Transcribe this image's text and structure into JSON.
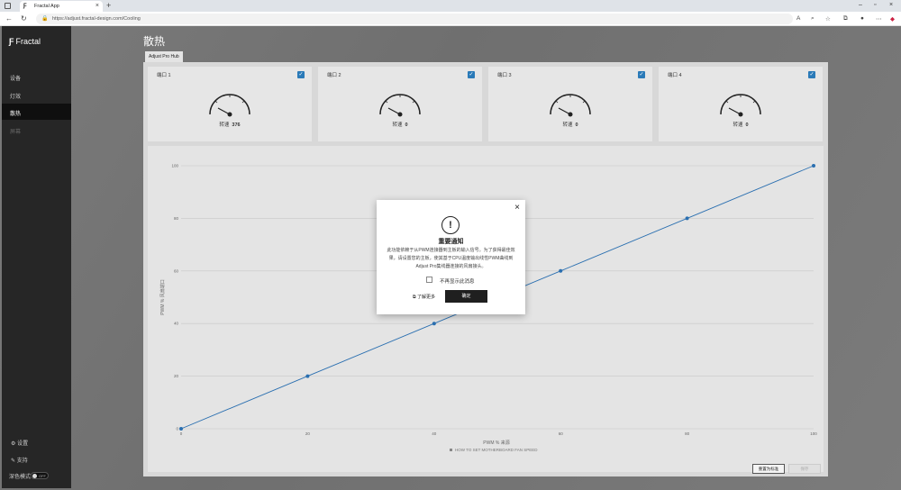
{
  "browser": {
    "tab_title": "Fractal App",
    "tab_favicon": "Ƒ",
    "url": "https://adjust.fractal-design.com/Cooling"
  },
  "sidebar": {
    "brand": "Fractal",
    "items": [
      {
        "label": "设备"
      },
      {
        "label": "灯效"
      },
      {
        "label": "散热"
      },
      {
        "label": "屏幕"
      }
    ],
    "settings_label": "设置",
    "support_label": "支持",
    "dark_mode_label": "深色模式",
    "dark_mode_state": "OFF"
  },
  "page": {
    "title": "散热",
    "hub_tab": "Adjust Pro Hub"
  },
  "fans": [
    {
      "port": "端口 1",
      "speed_label": "转速",
      "speed": "376",
      "needle": 0.2
    },
    {
      "port": "端口 2",
      "speed_label": "转速",
      "speed": "0",
      "needle": 0.2
    },
    {
      "port": "端口 3",
      "speed_label": "转速",
      "speed": "0",
      "needle": 0.2
    },
    {
      "port": "端口 4",
      "speed_label": "转速",
      "speed": "0",
      "needle": 0.2
    }
  ],
  "chart_data": {
    "type": "line",
    "x": [
      0,
      20,
      40,
      60,
      80,
      100
    ],
    "y": [
      0,
      20,
      40,
      60,
      80,
      100
    ],
    "xlabel": "PWM % 来源",
    "ylabel": "PWM % 风扇端口",
    "xlim": [
      0,
      100
    ],
    "ylim": [
      0,
      100
    ],
    "xticks": [
      "0",
      "20",
      "40",
      "60",
      "80",
      "100"
    ],
    "yticks": [
      "0",
      "20",
      "40",
      "60",
      "80",
      "100"
    ],
    "legend": "HOW TO SET MOTHERBOARD FAN SPEED",
    "line_color": "#2a6fb0"
  },
  "buttons": {
    "reset": "重置为标准",
    "save": "保存"
  },
  "modal": {
    "title": "重要通知",
    "body": "此功能依赖于从PWM连接器到主板的输入信号。为了获得最佳效果，请设置您的主板，使其基于CPU温度输出线性PWM曲线到Adjust Pro集线器连接的风扇接头。",
    "checkbox_label": "不再显示此消息",
    "learn_more": "了解更多",
    "ok": "确定"
  }
}
